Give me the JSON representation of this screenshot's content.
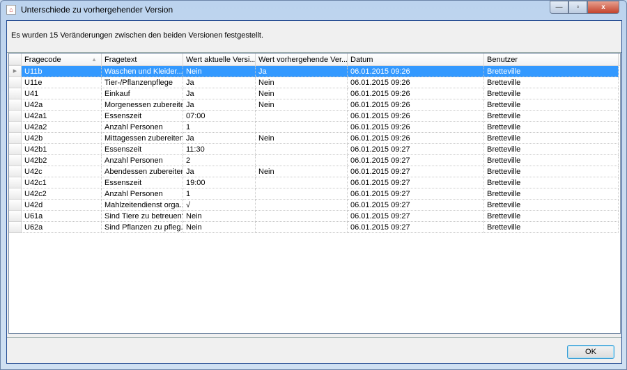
{
  "window": {
    "title": "Unterschiede zu vorhergehender Version",
    "minimize": "—",
    "maximize": "▫",
    "close": "x"
  },
  "message": "Es wurden 15 Veränderungen zwischen den beiden Versionen festgestellt.",
  "columns": [
    "Fragecode",
    "Fragetext",
    "Wert aktuelle Versi...",
    "Wert vorhergehende Ver...",
    "Datum",
    "Benutzer"
  ],
  "rows": [
    [
      "U11b",
      "Waschen und Kleider...",
      "Nein",
      "Ja",
      "06.01.2015 09:26",
      "Bretteville"
    ],
    [
      "U11e",
      "Tier-/Pflanzenpflege",
      "Ja",
      "Nein",
      "06.01.2015 09:26",
      "Bretteville"
    ],
    [
      "U41",
      "Einkauf",
      "Ja",
      "Nein",
      "06.01.2015 09:26",
      "Bretteville"
    ],
    [
      "U42a",
      "Morgenessen zubereiten",
      "Ja",
      "Nein",
      "06.01.2015 09:26",
      "Bretteville"
    ],
    [
      "U42a1",
      "Essenszeit",
      "07:00",
      "",
      "06.01.2015 09:26",
      "Bretteville"
    ],
    [
      "U42a2",
      "Anzahl Personen",
      "1",
      "",
      "06.01.2015 09:26",
      "Bretteville"
    ],
    [
      "U42b",
      "Mittagessen zubereiten",
      "Ja",
      "Nein",
      "06.01.2015 09:26",
      "Bretteville"
    ],
    [
      "U42b1",
      "Essenszeit",
      "11:30",
      "",
      "06.01.2015 09:27",
      "Bretteville"
    ],
    [
      "U42b2",
      "Anzahl Personen",
      "2",
      "",
      "06.01.2015 09:27",
      "Bretteville"
    ],
    [
      "U42c",
      "Abendessen zubereiten",
      "Ja",
      "Nein",
      "06.01.2015 09:27",
      "Bretteville"
    ],
    [
      "U42c1",
      "Essenszeit",
      "19:00",
      "",
      "06.01.2015 09:27",
      "Bretteville"
    ],
    [
      "U42c2",
      "Anzahl Personen",
      "1",
      "",
      "06.01.2015 09:27",
      "Bretteville"
    ],
    [
      "U42d",
      "Mahlzeitendienst orga...",
      "√",
      "",
      "06.01.2015 09:27",
      "Bretteville"
    ],
    [
      "U61a",
      "Sind Tiere zu betreuen?",
      "Nein",
      "",
      "06.01.2015 09:27",
      "Bretteville"
    ],
    [
      "U62a",
      "Sind Pflanzen zu pfleg...",
      "Nein",
      "",
      "06.01.2015 09:27",
      "Bretteville"
    ]
  ],
  "selected_row": 0,
  "ok_label": "OK"
}
